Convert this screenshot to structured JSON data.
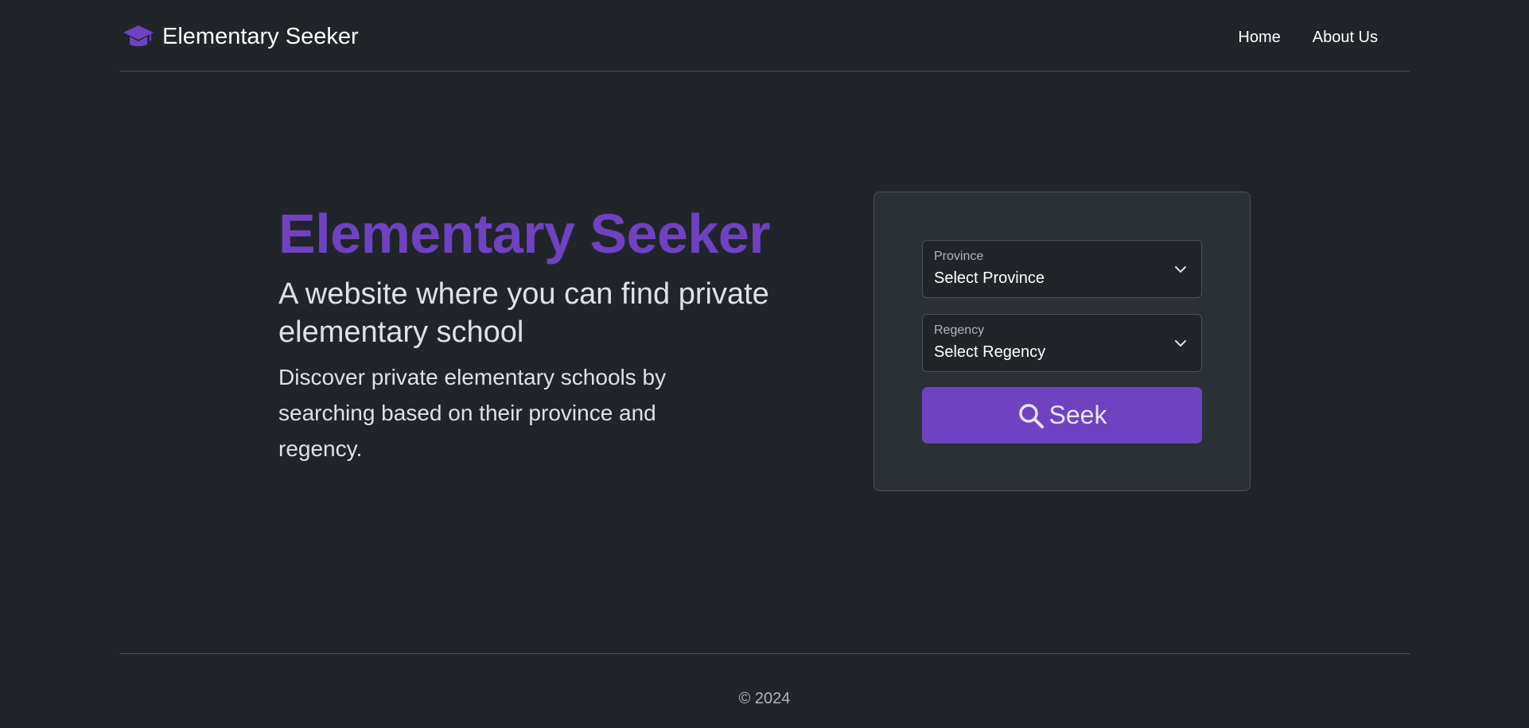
{
  "header": {
    "brand": "Elementary Seeker",
    "brand_icon": "graduation-cap-icon",
    "nav": [
      {
        "label": "Home"
      },
      {
        "label": "About Us"
      }
    ]
  },
  "hero": {
    "title": "Elementary Seeker",
    "subtitle": "A website where you can find private elementary school",
    "description": "Discover private elementary schools by searching based on their province and regency."
  },
  "search": {
    "province": {
      "label": "Province",
      "value": "Select Province"
    },
    "regency": {
      "label": "Regency",
      "value": "Select Regency"
    },
    "button_label": "Seek",
    "button_icon": "search-icon"
  },
  "footer": {
    "copyright": "© 2024"
  },
  "colors": {
    "background": "#212529",
    "accent": "#6f42c1",
    "card": "#2b3035",
    "border": "#495057"
  }
}
